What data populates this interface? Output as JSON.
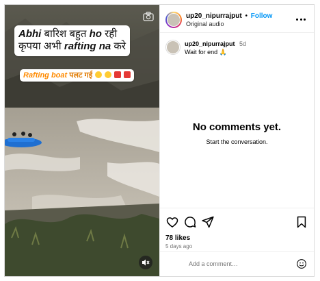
{
  "media": {
    "caption_line1_parts": [
      "Abhi",
      " बारिश बहुत ",
      "ho",
      " रही"
    ],
    "caption_line2_parts": [
      "कृपया अभी ",
      "rafting na",
      " करे"
    ],
    "caption_sub_bold": "Rafting boat",
    "caption_sub_rest": " पलट गई",
    "icons": [
      "camera-icon",
      "muted-speaker-icon"
    ],
    "colors": {
      "water": "#b9b2a5",
      "cliff": "#4a4a42",
      "raft": "#1f6fd1",
      "accent": "#ff8a00"
    }
  },
  "header": {
    "username": "up20_nipurrajput",
    "separator": "•",
    "follow_label": "Follow",
    "audio_label": "Original audio"
  },
  "caption": {
    "username": "up20_nipurrajput",
    "time": "5d",
    "text": "Wait for end 🙏"
  },
  "comments": {
    "empty_title": "No comments yet.",
    "empty_subtitle": "Start the conversation."
  },
  "actions": {
    "likes": "78 likes",
    "posted": "5 days ago"
  },
  "comment_box": {
    "placeholder": "Add a comment…"
  },
  "colors": {
    "follow": "#0095f6",
    "border": "#dbdbdb",
    "muted": "#737373"
  }
}
